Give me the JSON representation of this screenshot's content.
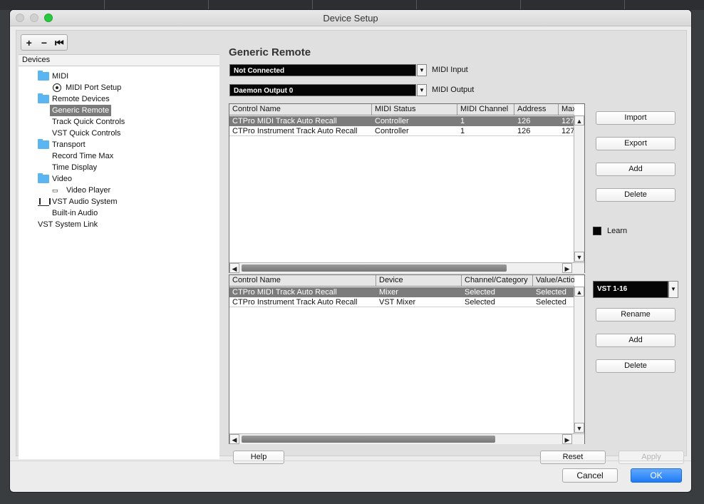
{
  "window": {
    "title": "Device Setup"
  },
  "tree": {
    "toolbar": {
      "add": "+",
      "remove": "−",
      "reset": "⏮"
    },
    "header": "Devices",
    "items": [
      {
        "label": "MIDI",
        "icon": "folder-icon"
      },
      {
        "label": "MIDI Port Setup",
        "icon": "midi-port-icon"
      },
      {
        "label": "Remote Devices",
        "icon": "folder-icon"
      },
      {
        "label": "Generic Remote",
        "icon": ""
      },
      {
        "label": "Track Quick Controls",
        "icon": ""
      },
      {
        "label": "VST Quick Controls",
        "icon": ""
      },
      {
        "label": "Transport",
        "icon": "folder-icon"
      },
      {
        "label": "Record Time Max",
        "icon": ""
      },
      {
        "label": "Time Display",
        "icon": ""
      },
      {
        "label": "Video",
        "icon": "folder-icon"
      },
      {
        "label": "Video Player",
        "icon": "video-icon"
      },
      {
        "label": "VST Audio System",
        "icon": "audio-icon"
      },
      {
        "label": "Built-in Audio",
        "icon": ""
      },
      {
        "label": "VST System Link",
        "icon": ""
      }
    ],
    "selected_index": 3
  },
  "main": {
    "title": "Generic Remote",
    "midi_input": {
      "value": "Not Connected",
      "label": "MIDI Input"
    },
    "midi_output": {
      "value": "Daemon Output 0",
      "label": "MIDI Output"
    },
    "upper_table": {
      "columns": [
        "Control Name",
        "MIDI Status",
        "MIDI Channel",
        "Address",
        "Max. V"
      ],
      "rows": [
        [
          "CTPro MIDI Track Auto Recall",
          "Controller",
          "1",
          "126",
          "127"
        ],
        [
          "CTPro Instrument Track Auto Recall",
          "Controller",
          "1",
          "126",
          "127"
        ]
      ]
    },
    "upper_buttons": {
      "import": "Import",
      "export": "Export",
      "add": "Add",
      "delete": "Delete"
    },
    "learn_label": "Learn",
    "lower_table": {
      "columns": [
        "Control Name",
        "Device",
        "Channel/Category",
        "Value/Action"
      ],
      "rows": [
        [
          "CTPro MIDI Track Auto Recall",
          "Mixer",
          "Selected",
          "Selected"
        ],
        [
          "CTPro Instrument Track Auto Recall",
          "VST Mixer",
          "Selected",
          "Selected"
        ]
      ]
    },
    "bank_select": {
      "value": "VST 1-16"
    },
    "lower_buttons": {
      "rename": "Rename",
      "add": "Add",
      "delete": "Delete"
    },
    "help_label": "Help",
    "reset_label": "Reset",
    "apply_label": "Apply"
  },
  "footer": {
    "cancel_label": "Cancel",
    "ok_label": "OK"
  },
  "colors": {
    "selection": "#7c7c7c",
    "folder": "#5ab5f0",
    "primary": "#1f7cf5",
    "zoom": "#28c840"
  }
}
